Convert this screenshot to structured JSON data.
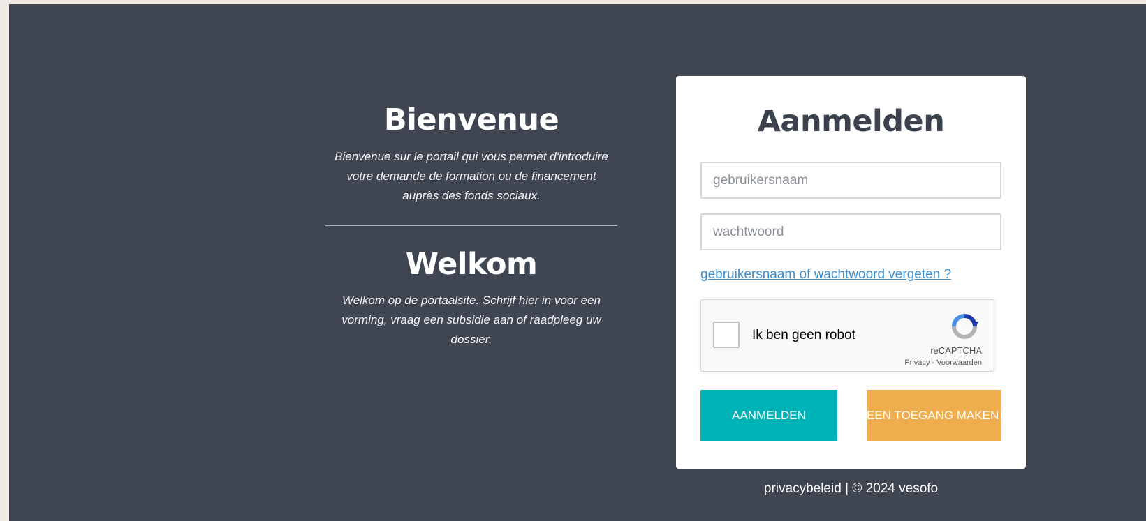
{
  "welcome": {
    "fr_title": "Bienvenue",
    "fr_text": "Bienvenue sur le portail qui vous permet d'introduire votre demande de formation ou de financement auprès des fonds sociaux.",
    "nl_title": "Welkom",
    "nl_text": "Welkom op de portaalsite. Schrijf hier in voor een vorming, vraag een subsidie aan of raadpleeg uw dossier."
  },
  "login": {
    "title": "Aanmelden",
    "username_placeholder": "gebruikersnaam",
    "username_value": "",
    "password_placeholder": "wachtwoord",
    "password_value": "",
    "forgot_link": "gebruikersnaam of wachtwoord vergeten ?",
    "recaptcha": {
      "label": "Ik ben geen robot",
      "brand": "reCAPTCHA",
      "privacy": "Privacy",
      "separator": " - ",
      "terms": "Voorwaarden"
    },
    "submit_label": "AANMELDEN",
    "register_label": "EEN TOEGANG MAKEN ?"
  },
  "footer": {
    "privacy_link": "privacybeleid",
    "separator": " | ",
    "copyright": "© 2024 vesofo"
  },
  "colors": {
    "background": "#3f4651",
    "accent_teal": "#00b3b7",
    "accent_orange": "#f0ad4e",
    "link": "#3b8fd1"
  }
}
